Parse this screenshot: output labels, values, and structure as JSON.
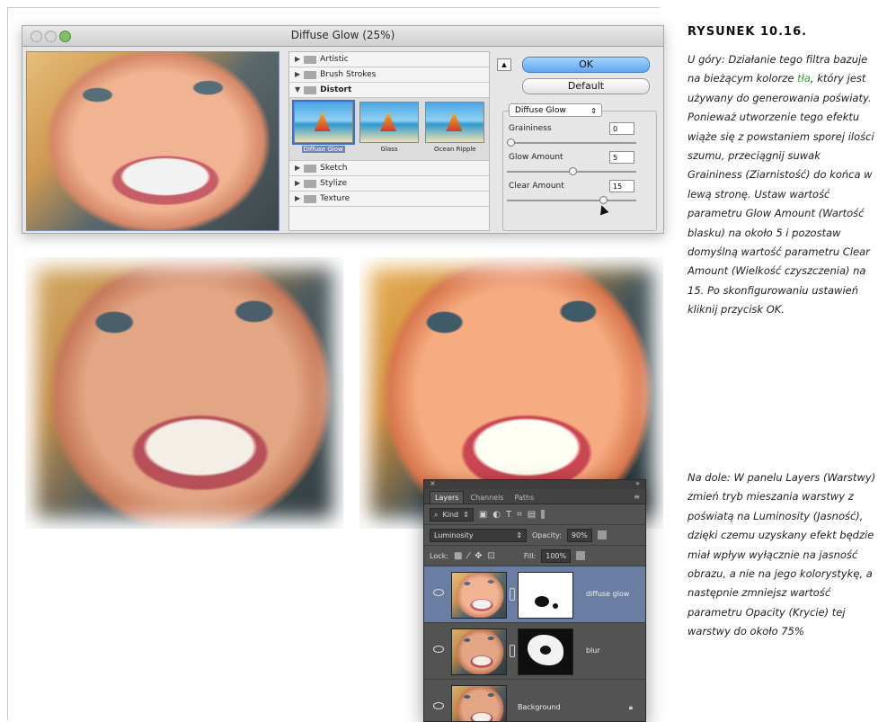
{
  "dialog": {
    "title": "Diffuse Glow (25%)",
    "gallery": {
      "categories_top": [
        {
          "label": "Artistic",
          "open": false
        },
        {
          "label": "Brush Strokes",
          "open": false
        },
        {
          "label": "Distort",
          "open": true
        }
      ],
      "thumbs": [
        {
          "label": "Diffuse Glow",
          "selected": true
        },
        {
          "label": "Glass",
          "selected": false
        },
        {
          "label": "Ocean Ripple",
          "selected": false
        }
      ],
      "categories_bottom": [
        {
          "label": "Sketch"
        },
        {
          "label": "Stylize"
        },
        {
          "label": "Texture"
        }
      ]
    },
    "buttons": {
      "collapse": "▲",
      "ok": "OK",
      "default": "Default"
    },
    "filter_select": "Diffuse Glow",
    "params": [
      {
        "label": "Graininess",
        "value": "0",
        "slider_fraction": 0.0
      },
      {
        "label": "Glow Amount",
        "value": "5",
        "slider_fraction": 0.5
      },
      {
        "label": "Clear Amount",
        "value": "15",
        "slider_fraction": 0.75
      }
    ]
  },
  "layers_panel": {
    "tabs": [
      "Layers",
      "Channels",
      "Paths"
    ],
    "kind_label": "Kind",
    "blend_mode": "Luminosity",
    "opacity_label": "Opacity:",
    "opacity_value": "90%",
    "lock_label": "Lock:",
    "fill_label": "Fill:",
    "fill_value": "100%",
    "layers": [
      {
        "name": "diffuse glow",
        "selected": true,
        "has_mask": true
      },
      {
        "name": "blur",
        "selected": false,
        "has_mask": true
      },
      {
        "name": "Background",
        "selected": false,
        "has_mask": false
      }
    ]
  },
  "caption": {
    "title": "RYSUNEK 10.16.",
    "p1_pre": "U góry: Działanie tego filtra bazuje na bieżącym kolorze ",
    "p1_highlight": "tła",
    "p1_post": ", który jest używany do generowania poświaty. Ponieważ utworzenie tego efektu wiąże się z powstaniem sporej ilości szumu, przeciągnij suwak Graininess (Ziarnistość) do końca w lewą stronę. Ustaw wartość parametru Glow Amount (Wartość blasku) na około 5 i pozostaw domyślną wartość parametru Clear Amount (Wielkość czyszczenia) na 15. Po skonfigurowaniu ustawień kliknij przycisk OK.",
    "p2": "Na dole: W panelu Layers (Warstwy) zmień tryb mieszania warstwy z poświatą na Luminosity (Jasność), dzięki czemu uzyskany efekt będzie miał wpływ wyłącznie na jasność obrazu, a nie na jego kolorystykę, a następnie zmniejsz wartość parametru Opacity (Krycie) tej warstwy do około 75%"
  },
  "colors": {
    "accent_link": "#3a9a3a",
    "ok_button": "#5fa6ee",
    "selected_layer": "#6a7ea3"
  }
}
